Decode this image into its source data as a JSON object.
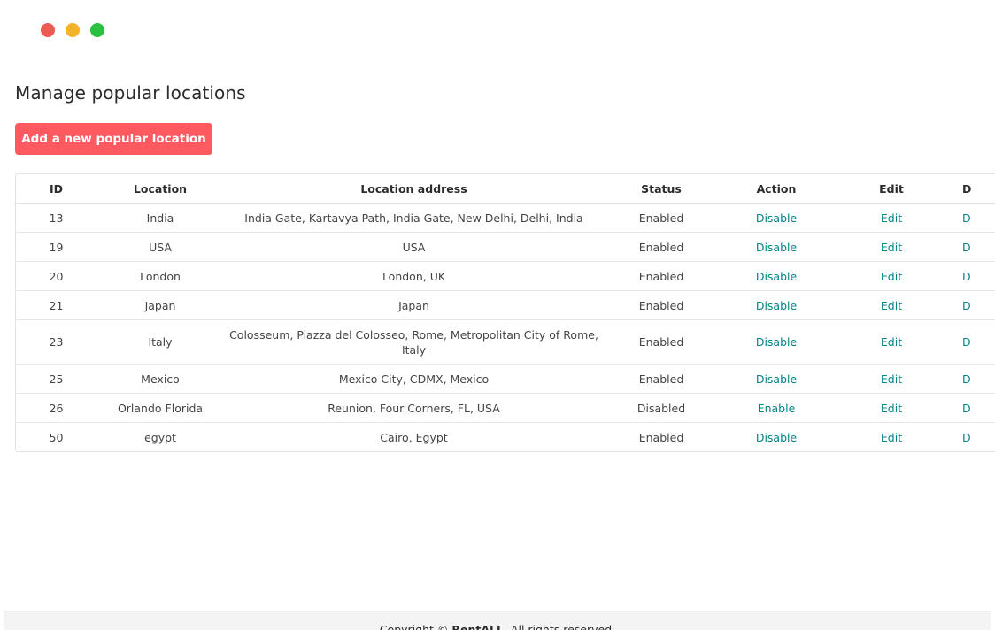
{
  "window": {
    "controls": {
      "close_color": "#ee5b53",
      "minimize_color": "#f5b327",
      "maximize_color": "#29c13f"
    }
  },
  "page": {
    "title": "Manage popular locations",
    "add_button_label": "Add a new popular location"
  },
  "table": {
    "headers": {
      "id": "ID",
      "location": "Location",
      "address": "Location address",
      "status": "Status",
      "action": "Action",
      "edit": "Edit",
      "delete": "D"
    },
    "rows": [
      {
        "id": "13",
        "location": "India",
        "address": "India Gate, Kartavya Path, India Gate, New Delhi, Delhi, India",
        "status": "Enabled",
        "action": "Disable",
        "edit": "Edit",
        "delete": "D"
      },
      {
        "id": "19",
        "location": "USA",
        "address": "USA",
        "status": "Enabled",
        "action": "Disable",
        "edit": "Edit",
        "delete": "D"
      },
      {
        "id": "20",
        "location": "London",
        "address": "London, UK",
        "status": "Enabled",
        "action": "Disable",
        "edit": "Edit",
        "delete": "D"
      },
      {
        "id": "21",
        "location": "Japan",
        "address": "Japan",
        "status": "Enabled",
        "action": "Disable",
        "edit": "Edit",
        "delete": "D"
      },
      {
        "id": "23",
        "location": "Italy",
        "address": "Colosseum, Piazza del Colosseo, Rome, Metropolitan City of Rome, Italy",
        "status": "Enabled",
        "action": "Disable",
        "edit": "Edit",
        "delete": "D"
      },
      {
        "id": "25",
        "location": "Mexico",
        "address": "Mexico City, CDMX, Mexico",
        "status": "Enabled",
        "action": "Disable",
        "edit": "Edit",
        "delete": "D"
      },
      {
        "id": "26",
        "location": "Orlando Florida",
        "address": "Reunion, Four Corners, FL, USA",
        "status": "Disabled",
        "action": "Enable",
        "edit": "Edit",
        "delete": "D"
      },
      {
        "id": "50",
        "location": "egypt",
        "address": "Cairo, Egypt",
        "status": "Enabled",
        "action": "Disable",
        "edit": "Edit",
        "delete": "D"
      }
    ]
  },
  "footer": {
    "prefix": "Copyright © ",
    "brand": "RentALL",
    "suffix": ". All rights reserved."
  },
  "colors": {
    "accent": "#ff5a5f",
    "link": "#008489",
    "text": "#2b2b2b",
    "border": "#e2e2e2"
  }
}
